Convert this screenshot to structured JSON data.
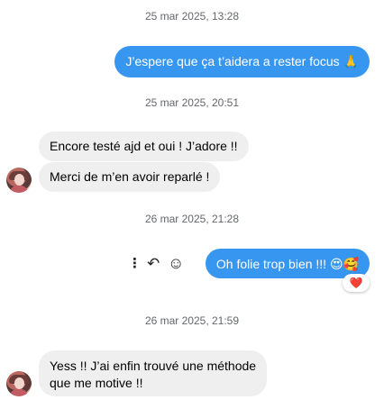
{
  "conversation": {
    "messages": [
      {
        "timestamp": "25 mar 2025, 13:28",
        "text": "J’espere que ça t’aidera a rester focus 🙏",
        "direction": "outgoing"
      },
      {
        "timestamp": "25 mar 2025, 20:51",
        "text": "Encore testé ajd et oui ! J’adore !!",
        "direction": "incoming"
      },
      {
        "text": "Merci de m’en avoir reparlé !",
        "direction": "incoming"
      },
      {
        "timestamp": "26 mar 2025, 21:28",
        "text": "Oh folie trop bien !!! 😍🥰",
        "direction": "outgoing",
        "reaction": "❤️"
      },
      {
        "timestamp": "26 mar 2025, 21:59",
        "text_line1": "Yess !! J’ai enfin trouvé une méthode",
        "text_line2": "que me motive !!",
        "direction": "incoming"
      }
    ]
  },
  "actions": {
    "more_icon": "⋮",
    "reply_icon": "↶",
    "emoji_icon": "☺"
  },
  "colors": {
    "outgoing_bubble": "#3797f0",
    "incoming_bubble": "#efefef",
    "timestamp": "#65676b"
  }
}
